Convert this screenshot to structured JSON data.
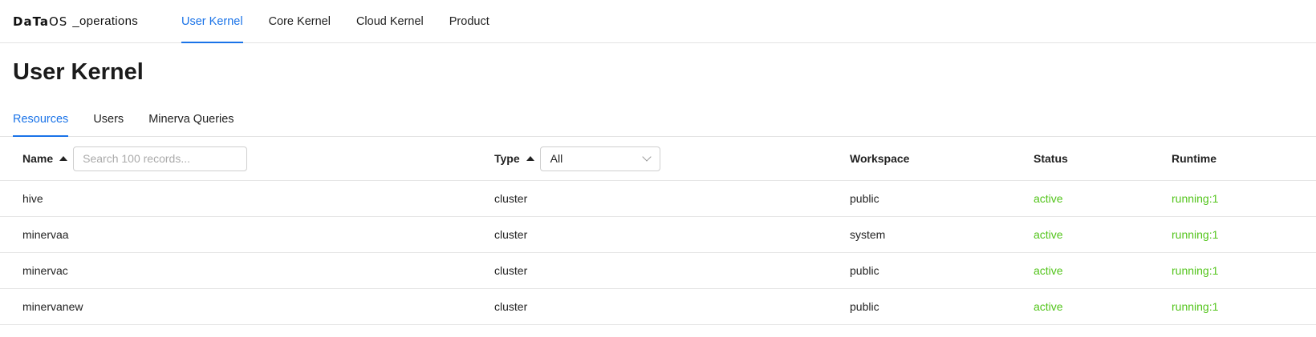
{
  "brand": {
    "bold": "DaTa",
    "light": "OS",
    "suffix": "_operations"
  },
  "nav": [
    {
      "label": "User Kernel",
      "active": true
    },
    {
      "label": "Core Kernel"
    },
    {
      "label": "Cloud Kernel"
    },
    {
      "label": "Product"
    }
  ],
  "page_title": "User Kernel",
  "subtabs": [
    {
      "label": "Resources",
      "active": true
    },
    {
      "label": "Users"
    },
    {
      "label": "Minerva Queries"
    }
  ],
  "table": {
    "headers": {
      "name": "Name",
      "type": "Type",
      "workspace": "Workspace",
      "status": "Status",
      "runtime": "Runtime"
    },
    "search_placeholder": "Search 100 records...",
    "type_filter": "All",
    "rows": [
      {
        "name": "hive",
        "type": "cluster",
        "workspace": "public",
        "status": "active",
        "runtime": "running:1"
      },
      {
        "name": "minervaa",
        "type": "cluster",
        "workspace": "system",
        "status": "active",
        "runtime": "running:1"
      },
      {
        "name": "minervac",
        "type": "cluster",
        "workspace": "public",
        "status": "active",
        "runtime": "running:1"
      },
      {
        "name": "minervanew",
        "type": "cluster",
        "workspace": "public",
        "status": "active",
        "runtime": "running:1"
      }
    ]
  },
  "colors": {
    "accent": "#1a73e8",
    "status_green": "#52c41a"
  }
}
